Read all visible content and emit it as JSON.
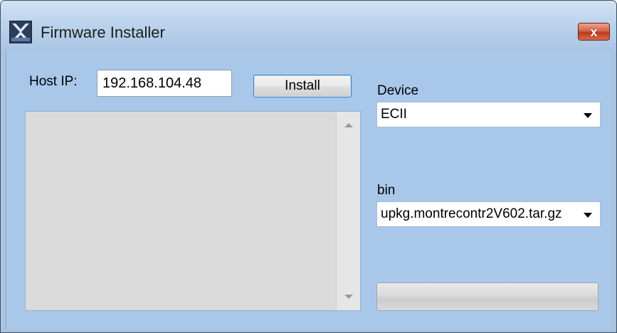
{
  "window": {
    "title": "Firmware Installer",
    "close_label": "x",
    "app_icon": "firmware-app-icon"
  },
  "form": {
    "host_ip_label": "Host IP:",
    "host_ip_value": "192.168.104.48",
    "install_label": "Install",
    "device_label": "Device",
    "device_value": "ECII",
    "bin_label": "bin",
    "bin_value": "upkg.montrecontr2V602.tar.gz"
  },
  "progress": {
    "value": 0
  },
  "colors": {
    "client_background": "#a9c7e9",
    "close_button": "#c2391c"
  }
}
